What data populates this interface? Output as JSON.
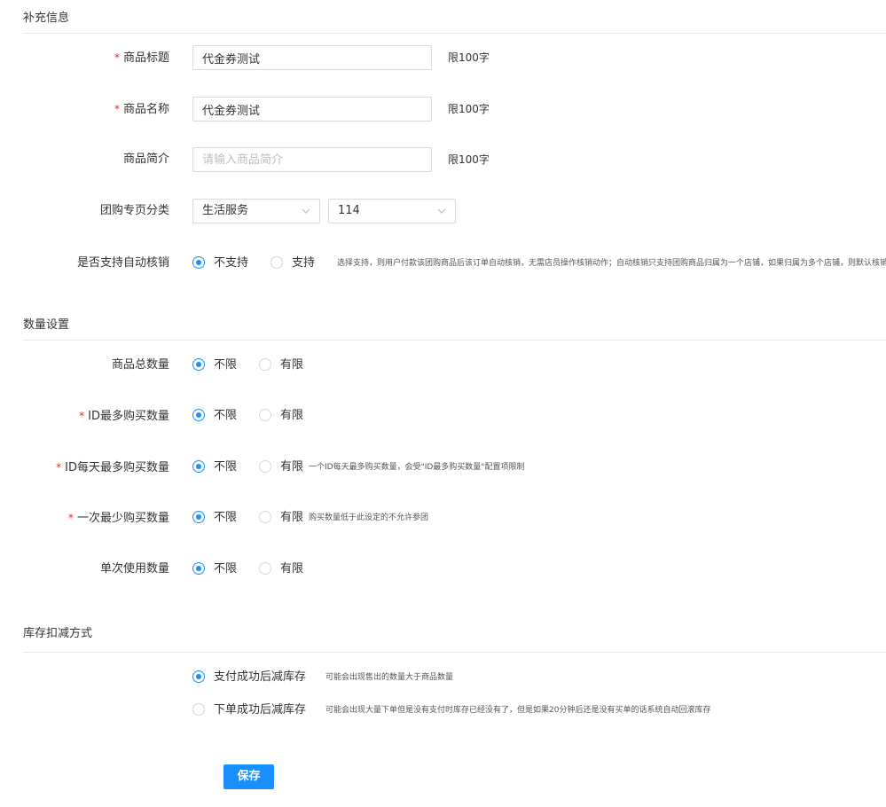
{
  "sections": {
    "supplement": "补充信息",
    "quantity": "数量设置",
    "stock": "库存扣减方式"
  },
  "supplement": {
    "title_field": {
      "label": "商品标题",
      "value": "代金券测试",
      "limit": "限100字"
    },
    "name_field": {
      "label": "商品名称",
      "value": "代金券测试",
      "limit": "限100字"
    },
    "intro_field": {
      "label": "商品简介",
      "placeholder": "请输入商品简介",
      "limit": "限100字"
    },
    "category": {
      "label": "团购专页分类",
      "select1": "生活服务",
      "select2": "114"
    },
    "auto_verify": {
      "label": "是否支持自动核销",
      "opt1": "不支持",
      "opt2": "支持",
      "hint": "选择支持，则用户付款该团购商品后该订单自动核销，无需店员操作核销动作；自动核销只支持团购商品归属为一个店铺，如果归属为多个店铺，则默认核销"
    }
  },
  "quantity": {
    "total": {
      "label": "商品总数量",
      "opt1": "不限",
      "opt2": "有限"
    },
    "id_max": {
      "label": "ID最多购买数量",
      "opt1": "不限",
      "opt2": "有限"
    },
    "id_daily": {
      "label": "ID每天最多购买数量",
      "opt1": "不限",
      "opt2": "有限",
      "hint": "一个ID每天最多购买数量，会受\"ID最多购买数量\"配置项限制"
    },
    "min_once": {
      "label": "一次最少购买数量",
      "opt1": "不限",
      "opt2": "有限",
      "hint": "购买数量低于此设定的不允许参团"
    },
    "single_use": {
      "label": "单次使用数量",
      "opt1": "不限",
      "opt2": "有限"
    }
  },
  "stock": {
    "opt1": "支付成功后减库存",
    "hint1": "可能会出现售出的数量大于商品数量",
    "opt2": "下单成功后减库存",
    "hint2": "可能会出现大量下单但是没有支付时库存已经没有了，但是如果20分钟后还是没有买单的话系统自动回滚库存"
  },
  "save_label": "保存",
  "colors": {
    "accent": "#1890ff",
    "required": "#f5222d",
    "border": "#d9d9d9"
  }
}
